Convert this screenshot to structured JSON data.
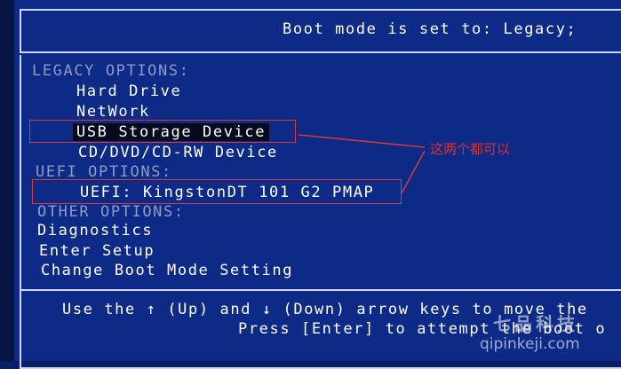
{
  "boot_mode_line": "Boot mode is set to: Legacy;",
  "sections": {
    "legacy": "LEGACY OPTIONS:",
    "uefi": "UEFI OPTIONS:",
    "other": "OTHER OPTIONS:"
  },
  "legacy_items": [
    "Hard Drive",
    "NetWork",
    "USB Storage Device",
    "CD/DVD/CD-RW Device"
  ],
  "uefi_items": [
    "UEFI: KingstonDT 101 G2 PMAP"
  ],
  "other_items": [
    "Diagnostics",
    "Enter Setup",
    "Change Boot Mode Setting"
  ],
  "selected_item": "USB Storage Device",
  "help": {
    "line1": "Use the ↑ (Up) and ↓ (Down) arrow keys to move the",
    "line2": "Press [Enter] to attempt the boot o"
  },
  "annotation": "这两个都可以",
  "watermark": {
    "cn": "七品科技",
    "url": "qipinkeji.com"
  },
  "colors": {
    "background": "#0d2a86",
    "text": "#ffffff",
    "section_header": "#8f9bc6",
    "selection_bg": "#050a1c",
    "annotation": "#e03030"
  }
}
